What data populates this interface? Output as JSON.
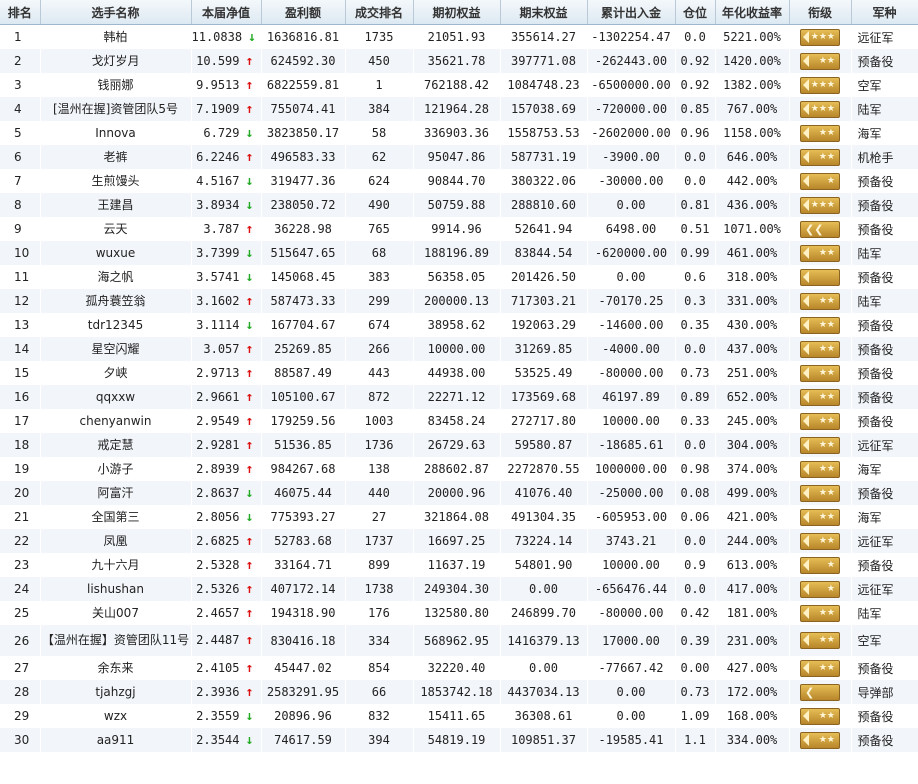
{
  "headers": [
    "排名",
    "选手名称",
    "本届净值",
    "盈利额",
    "成交排名",
    "期初权益",
    "期末权益",
    "累计出入金",
    "仓位",
    "年化收益率",
    "衔级",
    "军种"
  ],
  "rows": [
    {
      "rank": "1",
      "name": "韩柏",
      "nav": "11.0838",
      "dir": "down",
      "profit": "1636816.81",
      "trade_rank": "1735",
      "start": "21051.93",
      "end": "355614.27",
      "net_in": "-1302254.47",
      "pos": "0.0",
      "annual": "5221.00%",
      "badge": "stars3",
      "army": "远征军"
    },
    {
      "rank": "2",
      "name": "戈灯岁月",
      "nav": "10.599",
      "dir": "up",
      "profit": "624592.30",
      "trade_rank": "450",
      "start": "35621.78",
      "end": "397771.08",
      "net_in": "-262443.00",
      "pos": "0.92",
      "annual": "1420.00%",
      "badge": "stars2",
      "army": "预备役"
    },
    {
      "rank": "3",
      "name": "钱丽娜",
      "nav": "9.9513",
      "dir": "up",
      "profit": "6822559.81",
      "trade_rank": "1",
      "start": "762188.42",
      "end": "1084748.23",
      "net_in": "-6500000.00",
      "pos": "0.92",
      "annual": "1382.00%",
      "badge": "hook3",
      "army": "空军"
    },
    {
      "rank": "4",
      "name": "[温州在握]资管团队5号",
      "nav": "7.1909",
      "dir": "up",
      "profit": "755074.41",
      "trade_rank": "384",
      "start": "121964.28",
      "end": "157038.69",
      "net_in": "-720000.00",
      "pos": "0.85",
      "annual": "767.00%",
      "badge": "hook3",
      "army": "陆军"
    },
    {
      "rank": "5",
      "name": "Innova",
      "nav": "6.729",
      "dir": "down",
      "profit": "3823850.17",
      "trade_rank": "58",
      "start": "336903.36",
      "end": "1558753.53",
      "net_in": "-2602000.00",
      "pos": "0.96",
      "annual": "1158.00%",
      "badge": "stars2",
      "army": "海军"
    },
    {
      "rank": "6",
      "name": "老裤",
      "nav": "6.2246",
      "dir": "up",
      "profit": "496583.33",
      "trade_rank": "62",
      "start": "95047.86",
      "end": "587731.19",
      "net_in": "-3900.00",
      "pos": "0.0",
      "annual": "646.00%",
      "badge": "stars2",
      "army": "机枪手"
    },
    {
      "rank": "7",
      "name": "生煎馒头",
      "nav": "4.5167",
      "dir": "down",
      "profit": "319477.36",
      "trade_rank": "624",
      "start": "90844.70",
      "end": "380322.06",
      "net_in": "-30000.00",
      "pos": "0.0",
      "annual": "442.00%",
      "badge": "stars1",
      "army": "预备役"
    },
    {
      "rank": "8",
      "name": "王建昌",
      "nav": "3.8934",
      "dir": "down",
      "profit": "238050.72",
      "trade_rank": "490",
      "start": "50759.88",
      "end": "288810.60",
      "net_in": "0.00",
      "pos": "0.81",
      "annual": "436.00%",
      "badge": "stars3",
      "army": "预备役"
    },
    {
      "rank": "9",
      "name": "云天",
      "nav": "3.787",
      "dir": "up",
      "profit": "36228.98",
      "trade_rank": "765",
      "start": "9914.96",
      "end": "52641.94",
      "net_in": "6498.00",
      "pos": "0.51",
      "annual": "1071.00%",
      "badge": "chev2",
      "army": "预备役"
    },
    {
      "rank": "10",
      "name": "wuxue",
      "nav": "3.7399",
      "dir": "down",
      "profit": "515647.65",
      "trade_rank": "68",
      "start": "188196.89",
      "end": "83844.54",
      "net_in": "-620000.00",
      "pos": "0.99",
      "annual": "461.00%",
      "badge": "stars2",
      "army": "陆军"
    },
    {
      "rank": "11",
      "name": "海之帆",
      "nav": "3.5741",
      "dir": "down",
      "profit": "145068.45",
      "trade_rank": "383",
      "start": "56358.05",
      "end": "201426.50",
      "net_in": "0.00",
      "pos": "0.6",
      "annual": "318.00%",
      "badge": "hook0",
      "army": "预备役"
    },
    {
      "rank": "12",
      "name": "孤舟蓑笠翁",
      "nav": "3.1602",
      "dir": "up",
      "profit": "587473.33",
      "trade_rank": "299",
      "start": "200000.13",
      "end": "717303.21",
      "net_in": "-70170.25",
      "pos": "0.3",
      "annual": "331.00%",
      "badge": "stars2",
      "army": "陆军"
    },
    {
      "rank": "13",
      "name": "tdr12345",
      "nav": "3.1114",
      "dir": "down",
      "profit": "167704.67",
      "trade_rank": "674",
      "start": "38958.62",
      "end": "192063.29",
      "net_in": "-14600.00",
      "pos": "0.35",
      "annual": "430.00%",
      "badge": "stars2",
      "army": "预备役"
    },
    {
      "rank": "14",
      "name": "星空闪耀",
      "nav": "3.057",
      "dir": "up",
      "profit": "25269.85",
      "trade_rank": "266",
      "start": "10000.00",
      "end": "31269.85",
      "net_in": "-4000.00",
      "pos": "0.0",
      "annual": "437.00%",
      "badge": "stars2",
      "army": "预备役"
    },
    {
      "rank": "15",
      "name": "夕峡",
      "nav": "2.9713",
      "dir": "up",
      "profit": "88587.49",
      "trade_rank": "443",
      "start": "44938.00",
      "end": "53525.49",
      "net_in": "-80000.00",
      "pos": "0.73",
      "annual": "251.00%",
      "badge": "stars2",
      "army": "预备役"
    },
    {
      "rank": "16",
      "name": "qqxxw",
      "nav": "2.9661",
      "dir": "up",
      "profit": "105100.67",
      "trade_rank": "872",
      "start": "22271.12",
      "end": "173569.68",
      "net_in": "46197.89",
      "pos": "0.89",
      "annual": "652.00%",
      "badge": "stars2",
      "army": "预备役"
    },
    {
      "rank": "17",
      "name": "chenyanwin",
      "nav": "2.9549",
      "dir": "up",
      "profit": "179259.56",
      "trade_rank": "1003",
      "start": "83458.24",
      "end": "272717.80",
      "net_in": "10000.00",
      "pos": "0.33",
      "annual": "245.00%",
      "badge": "stars2",
      "army": "预备役"
    },
    {
      "rank": "18",
      "name": "戒定慧",
      "nav": "2.9281",
      "dir": "up",
      "profit": "51536.85",
      "trade_rank": "1736",
      "start": "26729.63",
      "end": "59580.87",
      "net_in": "-18685.61",
      "pos": "0.0",
      "annual": "304.00%",
      "badge": "stars2",
      "army": "远征军"
    },
    {
      "rank": "19",
      "name": "小游子",
      "nav": "2.8939",
      "dir": "up",
      "profit": "984267.68",
      "trade_rank": "138",
      "start": "288602.87",
      "end": "2272870.55",
      "net_in": "1000000.00",
      "pos": "0.98",
      "annual": "374.00%",
      "badge": "stars2",
      "army": "海军"
    },
    {
      "rank": "20",
      "name": "阿富汗",
      "nav": "2.8637",
      "dir": "down",
      "profit": "46075.44",
      "trade_rank": "440",
      "start": "20000.96",
      "end": "41076.40",
      "net_in": "-25000.00",
      "pos": "0.08",
      "annual": "499.00%",
      "badge": "stars2",
      "army": "预备役"
    },
    {
      "rank": "21",
      "name": "全国第三",
      "nav": "2.8056",
      "dir": "down",
      "profit": "775393.27",
      "trade_rank": "27",
      "start": "321864.08",
      "end": "491304.35",
      "net_in": "-605953.00",
      "pos": "0.06",
      "annual": "421.00%",
      "badge": "stars2",
      "army": "海军"
    },
    {
      "rank": "22",
      "name": "凤凰",
      "nav": "2.6825",
      "dir": "up",
      "profit": "52783.68",
      "trade_rank": "1737",
      "start": "16697.25",
      "end": "73224.14",
      "net_in": "3743.21",
      "pos": "0.0",
      "annual": "244.00%",
      "badge": "stars2",
      "army": "远征军"
    },
    {
      "rank": "23",
      "name": "九十六月",
      "nav": "2.5328",
      "dir": "up",
      "profit": "33164.71",
      "trade_rank": "899",
      "start": "11637.19",
      "end": "54801.90",
      "net_in": "10000.00",
      "pos": "0.9",
      "annual": "613.00%",
      "badge": "stars1",
      "army": "预备役"
    },
    {
      "rank": "24",
      "name": "lishushan",
      "nav": "2.5326",
      "dir": "up",
      "profit": "407172.14",
      "trade_rank": "1738",
      "start": "249304.30",
      "end": "0.00",
      "net_in": "-656476.44",
      "pos": "0.0",
      "annual": "417.00%",
      "badge": "stars1",
      "army": "远征军"
    },
    {
      "rank": "25",
      "name": "关山007",
      "nav": "2.4657",
      "dir": "up",
      "profit": "194318.90",
      "trade_rank": "176",
      "start": "132580.80",
      "end": "246899.70",
      "net_in": "-80000.00",
      "pos": "0.42",
      "annual": "181.00%",
      "badge": "stars2",
      "army": "陆军"
    },
    {
      "rank": "26",
      "name": "【温州在握】资管团队11号",
      "nav": "2.4487",
      "dir": "up",
      "profit": "830416.18",
      "trade_rank": "334",
      "start": "568962.95",
      "end": "1416379.13",
      "net_in": "17000.00",
      "pos": "0.39",
      "annual": "231.00%",
      "badge": "stars2",
      "army": "空军",
      "tall": true
    },
    {
      "rank": "27",
      "name": "余东来",
      "nav": "2.4105",
      "dir": "up",
      "profit": "45447.02",
      "trade_rank": "854",
      "start": "32220.40",
      "end": "0.00",
      "net_in": "-77667.42",
      "pos": "0.00",
      "annual": "427.00%",
      "badge": "stars2",
      "army": "预备役"
    },
    {
      "rank": "28",
      "name": "tjahzgj",
      "nav": "2.3936",
      "dir": "up",
      "profit": "2583291.95",
      "trade_rank": "66",
      "start": "1853742.18",
      "end": "4437034.13",
      "net_in": "0.00",
      "pos": "0.73",
      "annual": "172.00%",
      "badge": "chev1",
      "army": "导弹部"
    },
    {
      "rank": "29",
      "name": "wzx",
      "nav": "2.3559",
      "dir": "down",
      "profit": "20896.96",
      "trade_rank": "832",
      "start": "15411.65",
      "end": "36308.61",
      "net_in": "0.00",
      "pos": "1.09",
      "annual": "168.00%",
      "badge": "stars2",
      "army": "预备役"
    },
    {
      "rank": "30",
      "name": "aa911",
      "nav": "2.3544",
      "dir": "down",
      "profit": "74617.59",
      "trade_rank": "394",
      "start": "54819.19",
      "end": "109851.37",
      "net_in": "-19585.41",
      "pos": "1.1",
      "annual": "334.00%",
      "badge": "stars2",
      "army": "预备役"
    }
  ]
}
